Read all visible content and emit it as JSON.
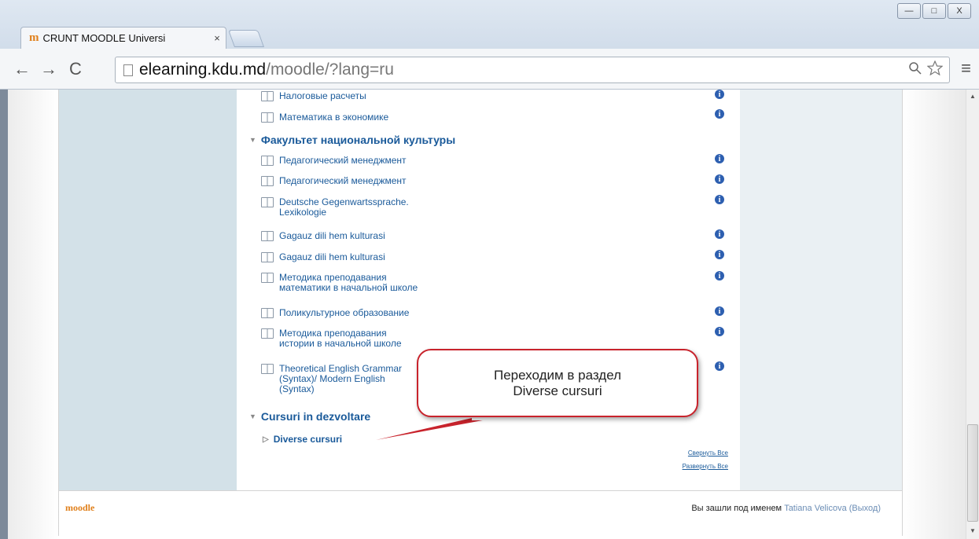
{
  "browser": {
    "tab_title": "CRUNT MOODLE Universi",
    "tab_logo": "m",
    "tab_close": "×",
    "url_host": "elearning.kdu.md",
    "url_path": "/moodle/?lang=ru",
    "back": "←",
    "forward": "→",
    "reload": "C",
    "zoom_icon": "search-icon",
    "star_icon": "star-icon",
    "menu": "≡",
    "win_minimize": "—",
    "win_maximize": "□",
    "win_close": "X"
  },
  "categories": [
    {
      "label": "Факультет национальной культуры"
    },
    {
      "label": "Cursuri in dezvoltare"
    }
  ],
  "courses": [
    {
      "label": "Налоговые расчеты"
    },
    {
      "label": "Математика в экономике"
    },
    {
      "label": "Педагогический менеджмент"
    },
    {
      "label": "Педагогический менеджмент"
    },
    {
      "label": "Deutsche Gegenwartssprache.",
      "label2": "Lexikologie"
    },
    {
      "label": "Gagauz dili hem kulturasi"
    },
    {
      "label": "Gagauz dili hem kulturasi"
    },
    {
      "label": "Методика преподавания",
      "label2": "математики в начальной школе"
    },
    {
      "label": "Поликультурное образование"
    },
    {
      "label": "Методика преподавания",
      "label2": "истории в начальной школе"
    },
    {
      "label": "Theoretical English Grammar",
      "label2": "(Syntax)/ Modern English",
      "label3": "(Syntax)"
    }
  ],
  "subcategory": {
    "label": "Diverse cursuri"
  },
  "links": {
    "collapse_all": "Свернуть Все",
    "expand_all": "Развернуть Все"
  },
  "callout": {
    "line1": "Переходим в раздел",
    "line2": "Diverse cursuri"
  },
  "footer": {
    "logo": "moodle",
    "login_prefix": "Вы зашли под именем",
    "user": "Tatiana Velicova",
    "logout": "(Выход)"
  },
  "colors": {
    "link": "#1a5a9a",
    "callout_border": "#c8232c",
    "left_column": "#d3e1e8",
    "info_icon": "#2d5fb0"
  }
}
